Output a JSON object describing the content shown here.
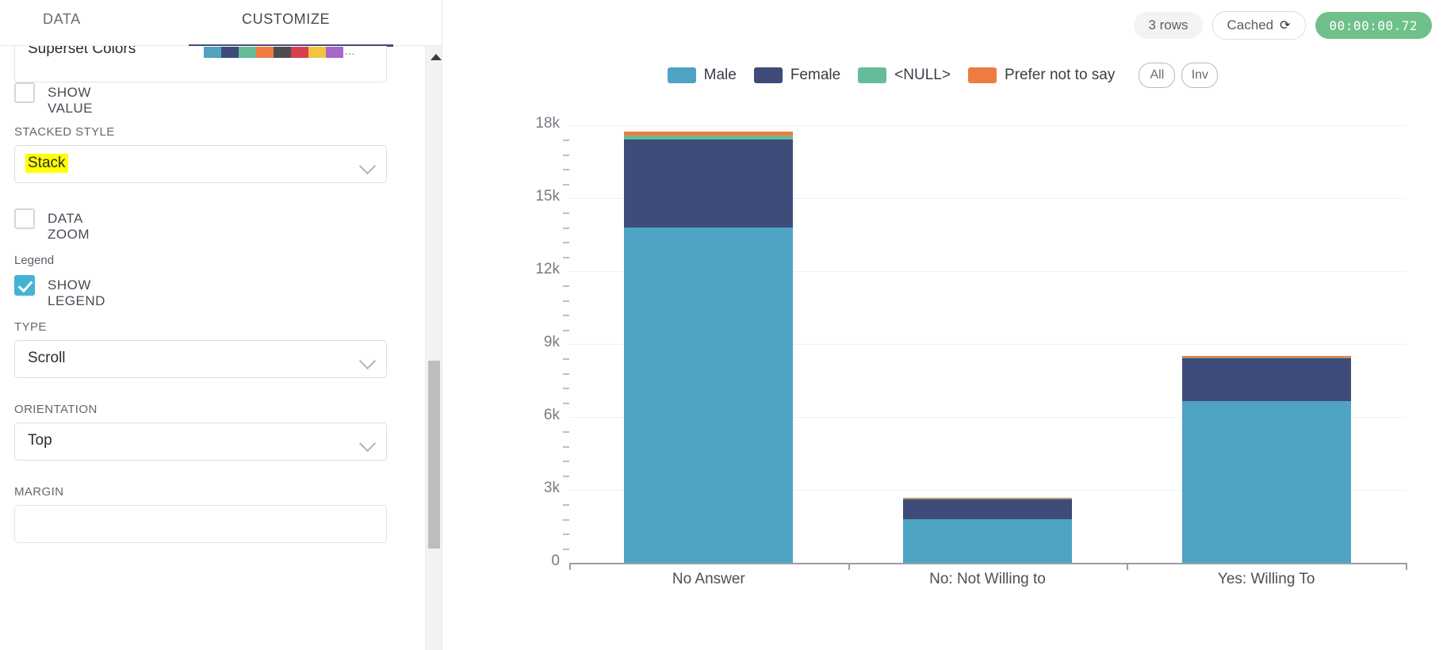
{
  "panel": {
    "tabs": [
      {
        "label": "DATA",
        "active": false
      },
      {
        "label": "CUSTOMIZE",
        "active": true
      }
    ],
    "color_scheme": {
      "label": "Superset Colors",
      "swatches": [
        "#4FA3C3",
        "#3F4B78",
        "#66BC98",
        "#EE7B42",
        "#4D4D4D",
        "#D9404E",
        "#F5C342",
        "#A868C8"
      ],
      "more": "..."
    },
    "show_value": {
      "label": "SHOW VALUE",
      "checked": false
    },
    "stacked_style": {
      "label": "STACKED STYLE",
      "value": "Stack",
      "highlighted": true
    },
    "data_zoom": {
      "label": "DATA ZOOM",
      "checked": false
    },
    "legend_section": {
      "label": "Legend"
    },
    "show_legend": {
      "label": "SHOW LEGEND",
      "checked": true
    },
    "type": {
      "label": "TYPE",
      "value": "Scroll"
    },
    "orientation": {
      "label": "ORIENTATION",
      "value": "Top"
    },
    "margin": {
      "label": "MARGIN",
      "value": "",
      "placeholder": ""
    }
  },
  "status": {
    "rows": "3 rows",
    "cache": "Cached",
    "cache_icon": "refresh-icon",
    "timer": "00:00:00.72",
    "timer_color": "#6FC08B"
  },
  "legend": {
    "items": [
      {
        "label": "Male",
        "color": "#4FA3C3"
      },
      {
        "label": "Female",
        "color": "#3F4B78"
      },
      {
        "label": "<NULL>",
        "color": "#66BC98"
      },
      {
        "label": "Prefer not to say",
        "color": "#EE7B42"
      }
    ],
    "all_button": "All",
    "inv_button": "Inv"
  },
  "chart_data": {
    "type": "bar",
    "stacked": true,
    "title": "",
    "xlabel": "",
    "ylabel": "",
    "ylim": [
      0,
      18000
    ],
    "yticks": [
      "0",
      "3k",
      "6k",
      "9k",
      "12k",
      "15k",
      "18k"
    ],
    "ytick_values": [
      0,
      3000,
      6000,
      9000,
      12000,
      15000,
      18000
    ],
    "minor_ticks_per_interval": 4,
    "grid": true,
    "legend_position": "top",
    "categories": [
      "No Answer",
      "No: Not Willing to",
      "Yes: Willing To"
    ],
    "series": [
      {
        "name": "Male",
        "color": "#4FA3C3",
        "values": [
          13800,
          1800,
          6650
        ]
      },
      {
        "name": "Female",
        "color": "#3F4B78",
        "values": [
          3600,
          800,
          1750
        ]
      },
      {
        "name": "<NULL>",
        "color": "#66BC98",
        "values": [
          170,
          30,
          60
        ]
      },
      {
        "name": "Prefer not to say",
        "color": "#EE7B42",
        "values": [
          170,
          30,
          60
        ]
      }
    ],
    "totals": [
      17740,
      2660,
      8520
    ]
  }
}
